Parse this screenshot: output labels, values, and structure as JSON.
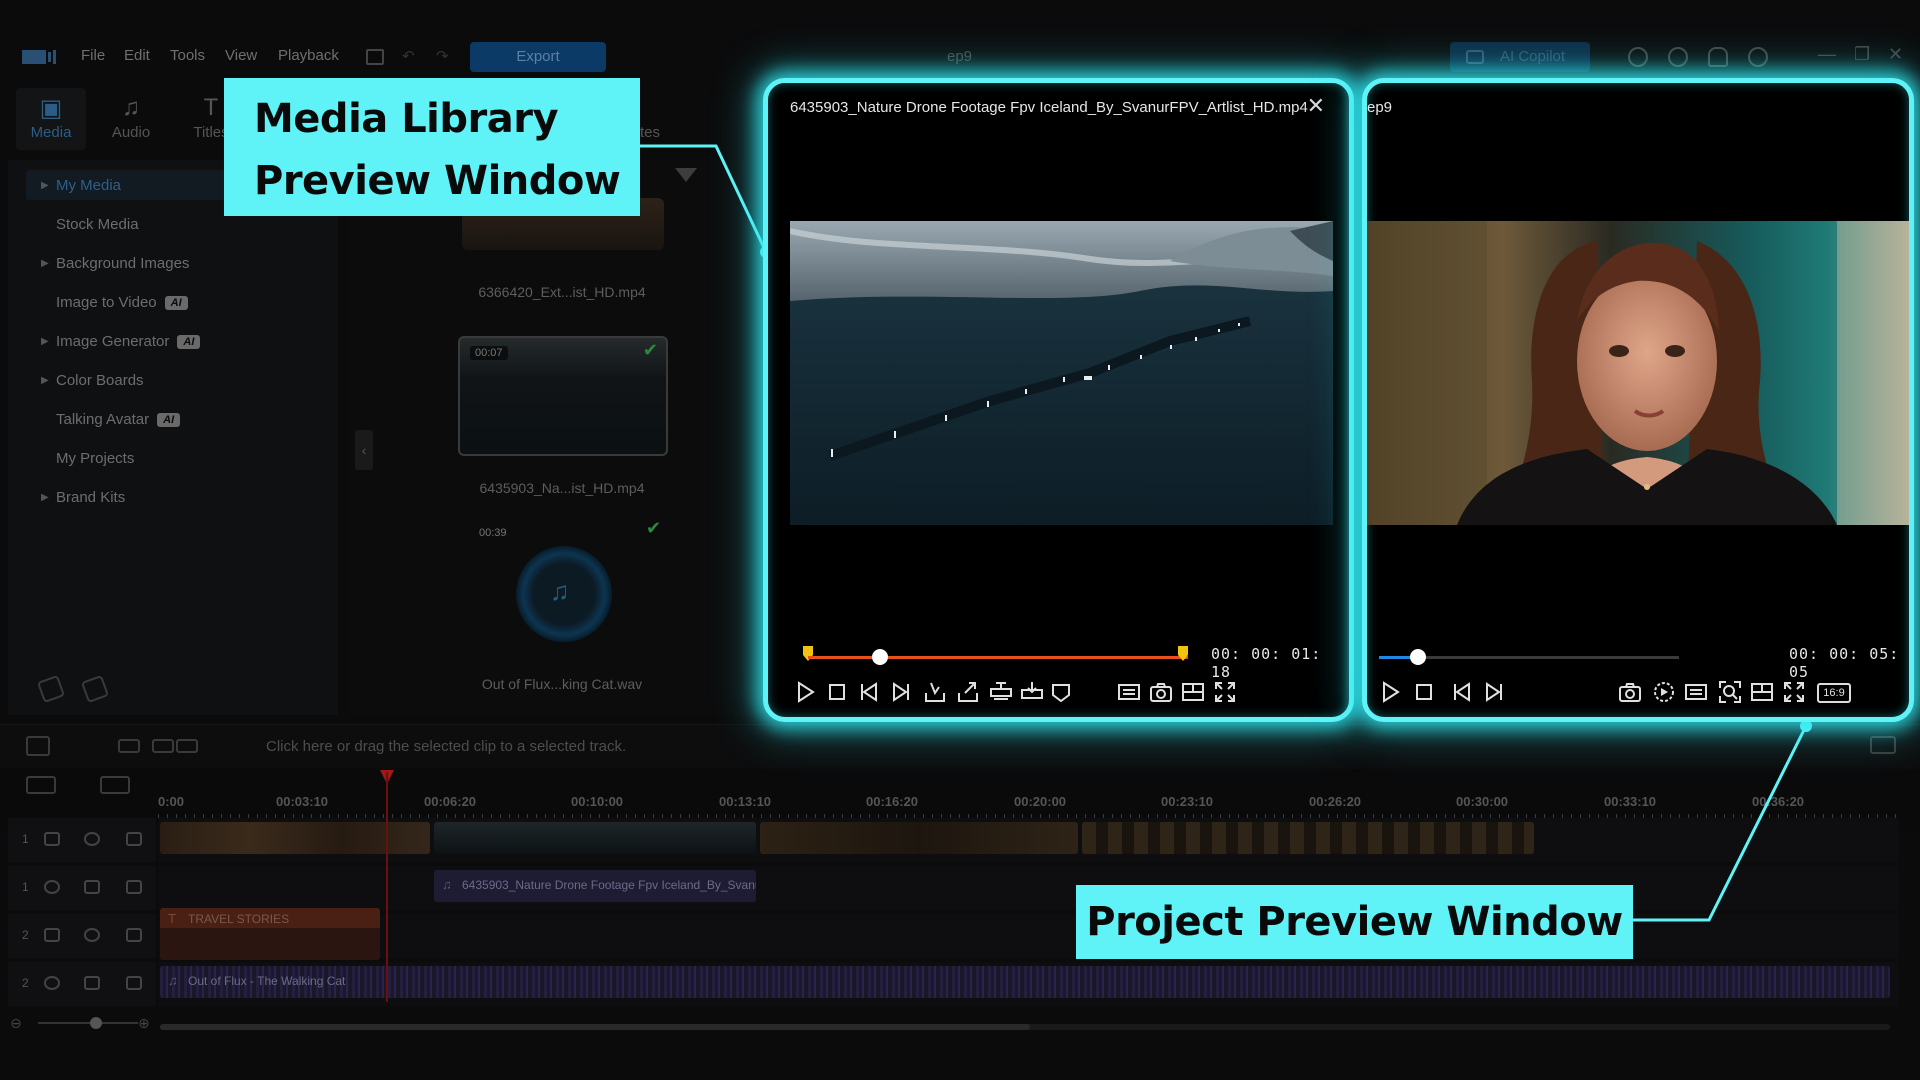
{
  "menubar": {
    "items": [
      "File",
      "Edit",
      "Tools",
      "View",
      "Playback"
    ],
    "export_label": "Export",
    "project_title": "ep9",
    "ai_copilot_label": "AI Copilot"
  },
  "left_tabs": [
    {
      "label": "Media",
      "icon": "media-icon"
    },
    {
      "label": "Audio",
      "icon": "music-note-icon"
    },
    {
      "label": "Titles",
      "icon": "text-t-icon"
    }
  ],
  "partial_tab_text": "tes",
  "sidebar": {
    "items": [
      {
        "label": "My Media",
        "arrow": true,
        "ai": false,
        "active": true
      },
      {
        "label": "Stock Media",
        "arrow": false,
        "ai": false
      },
      {
        "label": "Background Images",
        "arrow": true,
        "ai": false
      },
      {
        "label": "Image to Video",
        "arrow": false,
        "ai": true
      },
      {
        "label": "Image Generator",
        "arrow": true,
        "ai": true
      },
      {
        "label": "Color Boards",
        "arrow": true,
        "ai": false
      },
      {
        "label": "Talking Avatar",
        "arrow": false,
        "ai": true
      },
      {
        "label": "My Projects",
        "arrow": false,
        "ai": false
      },
      {
        "label": "Brand Kits",
        "arrow": true,
        "ai": false
      }
    ],
    "ai_badge": "AI"
  },
  "media_items": [
    {
      "label": "6366420_Ext...ist_HD.mp4"
    },
    {
      "label": "6435903_Na...ist_HD.mp4",
      "duration": "00:07"
    },
    {
      "label": "Out of Flux...king Cat.wav",
      "duration": "00:39"
    }
  ],
  "timeline": {
    "hint": "Click here or drag the selected clip to a selected track.",
    "ruler_labels": [
      "0:00",
      "00:03:10",
      "00:06:20",
      "00:10:00",
      "00:13:10",
      "00:16:20",
      "00:20:00",
      "00:23:10",
      "00:26:20",
      "00:30:00",
      "00:33:10",
      "00:36:20"
    ],
    "tracks": [
      {
        "num": "1",
        "type": "video"
      },
      {
        "num": "1",
        "type": "audio",
        "clip_label": "6435903_Nature Drone Footage Fpv Iceland_By_SvanurF"
      },
      {
        "num": "2",
        "type": "video",
        "clip_label": "TRAVEL STORIES"
      },
      {
        "num": "2",
        "type": "audio",
        "clip_label": "Out of Flux - The Walking Cat"
      }
    ]
  },
  "media_preview": {
    "title": "6435903_Nature Drone Footage Fpv Iceland_By_SvanurFPV_Artlist_HD.mp4",
    "timecode": "00: 00: 01: 18",
    "progress": 0.19,
    "accent": "#e8501c"
  },
  "project_preview": {
    "title": "ep9",
    "timecode": "00: 00: 05: 05",
    "progress": 0.13,
    "accent": "#1e88e5",
    "aspect_label": "16:9"
  },
  "callouts": {
    "media_line1": "Media Library",
    "media_line2": "Preview Window",
    "project": "Project Preview Window"
  },
  "colors": {
    "highlight": "#5ff3f8",
    "glow": "#2ee7f0"
  }
}
